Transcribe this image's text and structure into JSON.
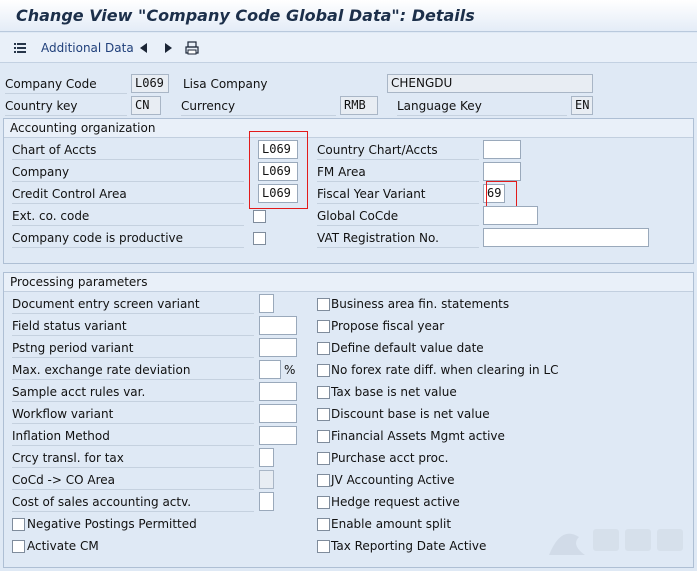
{
  "window": {
    "title": "Change View \"Company Code Global Data\": Details"
  },
  "toolbar": {
    "additional_data_label": "Additional Data",
    "icons": [
      "list-icon",
      "previous-icon",
      "next-icon",
      "print-icon"
    ]
  },
  "header": {
    "company_code_label": "Company Code",
    "company_code_value": "L069",
    "company_name": "Lisa Company",
    "city_value": "CHENGDU",
    "country_key_label": "Country key",
    "country_key_value": "CN",
    "currency_label": "Currency",
    "currency_value": "RMB",
    "language_key_label": "Language Key",
    "language_key_value": "EN"
  },
  "accounting_org": {
    "title": "Accounting organization",
    "chart_of_accts_label": "Chart of Accts",
    "chart_of_accts_value": "L069",
    "company_label": "Company",
    "company_value": "L069",
    "credit_control_area_label": "Credit Control Area",
    "credit_control_area_value": "L069",
    "ext_co_code_label": "Ext. co. code",
    "productive_label": "Company code is productive",
    "country_chart_label": "Country Chart/Accts",
    "country_chart_value": "",
    "fm_area_label": "FM Area",
    "fm_area_value": "",
    "fiscal_year_variant_label": "Fiscal Year Variant",
    "fiscal_year_variant_value": "69",
    "global_cocde_label": "Global CoCde",
    "global_cocde_value": "",
    "vat_reg_label": "VAT Registration No.",
    "vat_reg_value": ""
  },
  "processing": {
    "title": "Processing parameters",
    "left_fields": [
      {
        "label": "Document entry screen variant",
        "value": ""
      },
      {
        "label": "Field status variant",
        "value": ""
      },
      {
        "label": "Pstng period variant",
        "value": ""
      },
      {
        "label": "Max. exchange rate deviation",
        "value": ""
      },
      {
        "label": "Sample acct rules var.",
        "value": ""
      },
      {
        "label": "Workflow variant",
        "value": ""
      },
      {
        "label": "Inflation Method",
        "value": ""
      },
      {
        "label": "Crcy transl. for tax",
        "value": ""
      },
      {
        "label": "CoCd -> CO Area",
        "value": ""
      },
      {
        "label": "Cost of sales accounting actv.",
        "value": ""
      }
    ],
    "percent_sign": "%",
    "left_checkboxes": [
      "Negative Postings Permitted",
      "Activate CM"
    ],
    "right_checkboxes": [
      "Business area fin. statements",
      "Propose fiscal year",
      "Define default value date",
      "No forex rate diff. when clearing in LC",
      "Tax base is net value",
      "Discount base is net value",
      "Financial Assets Mgmt active",
      "Purchase acct proc.",
      "JV Accounting Active",
      "Hedge request active",
      "Enable amount split",
      "Tax Reporting Date Active"
    ]
  },
  "colors": {
    "highlight": "#e21b1b",
    "panel": "#dfe9f5"
  }
}
